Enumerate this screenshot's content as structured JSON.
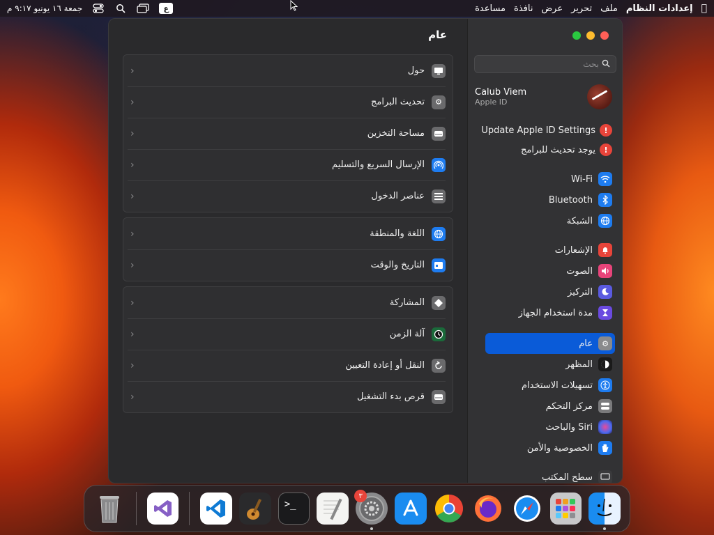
{
  "menubar": {
    "app_name": "إعدادات النظام",
    "items": [
      "ملف",
      "تحرير",
      "عرض",
      "نافذة",
      "مساعدة"
    ],
    "input_source": "ع",
    "clock": "جمعة ١٦ يونيو ٩:١٧ م"
  },
  "window": {
    "title": "عام",
    "search_placeholder": "بحث"
  },
  "account": {
    "name": "Calub Viem",
    "subtitle": "Apple ID"
  },
  "sidebar": {
    "alerts": [
      {
        "label": "Update Apple ID Settings",
        "badge": "!"
      },
      {
        "label": "يوجد تحديث للبرامج",
        "badge": "!"
      }
    ],
    "items": [
      {
        "label": "Wi-Fi",
        "icon": "wifi-icon",
        "color": "#1e7cf0"
      },
      {
        "label": "Bluetooth",
        "icon": "bluetooth-icon",
        "color": "#1e7cf0"
      },
      {
        "label": "الشبكة",
        "icon": "globe-icon",
        "color": "#1e7cf0"
      },
      {
        "label": "الإشعارات",
        "icon": "bell-icon",
        "color": "#e8443a"
      },
      {
        "label": "الصوت",
        "icon": "speaker-icon",
        "color": "#e8447a"
      },
      {
        "label": "التركيز",
        "icon": "moon-icon",
        "color": "#5a5ae0"
      },
      {
        "label": "مدة استخدام الجهاز",
        "icon": "hourglass-icon",
        "color": "#6a4ae0"
      },
      {
        "label": "عام",
        "icon": "gear-icon",
        "color": "#8a8a8c"
      },
      {
        "label": "المظهر",
        "icon": "appearance-icon",
        "color": "#1a1a1a"
      },
      {
        "label": "تسهيلات الاستخدام",
        "icon": "accessibility-icon",
        "color": "#1e7cf0"
      },
      {
        "label": "مركز التحكم",
        "icon": "control-center-icon",
        "color": "#7a7a7c"
      },
      {
        "label": "Siri والباحث",
        "icon": "siri-icon",
        "color": "#4a2a8a"
      },
      {
        "label": "الخصوصية والأمن",
        "icon": "hand-icon",
        "color": "#1e7cf0"
      },
      {
        "label": "سطح المكتب",
        "icon": "desktop-icon",
        "color": "#3a3a3c"
      }
    ],
    "selected_index": 7
  },
  "groups": [
    [
      {
        "label": "حول",
        "icon": "display-icon"
      },
      {
        "label": "تحديث البرامج",
        "icon": "gear-icon"
      },
      {
        "label": "مساحة التخزين",
        "icon": "drive-icon"
      },
      {
        "label": "الإرسال السريع والتسليم",
        "icon": "airdrop-icon"
      },
      {
        "label": "عناصر الدخول",
        "icon": "list-icon"
      }
    ],
    [
      {
        "label": "اللغة والمنطقة",
        "icon": "globe-icon"
      },
      {
        "label": "التاريخ والوقت",
        "icon": "calendar-icon"
      }
    ],
    [
      {
        "label": "المشاركة",
        "icon": "sharing-icon"
      },
      {
        "label": "آلة الزمن",
        "icon": "time-machine-icon"
      },
      {
        "label": "النقل أو إعادة التعيين",
        "icon": "reset-icon"
      },
      {
        "label": "قرص بدء التشغيل",
        "icon": "drive-icon"
      }
    ]
  ],
  "dock": {
    "settings_badge": "٣",
    "apps": [
      "trash",
      "visual-studio",
      "vscode",
      "garageband",
      "terminal",
      "textedit",
      "system-settings",
      "app-store",
      "chrome",
      "firefox",
      "safari",
      "launchpad",
      "finder"
    ]
  }
}
